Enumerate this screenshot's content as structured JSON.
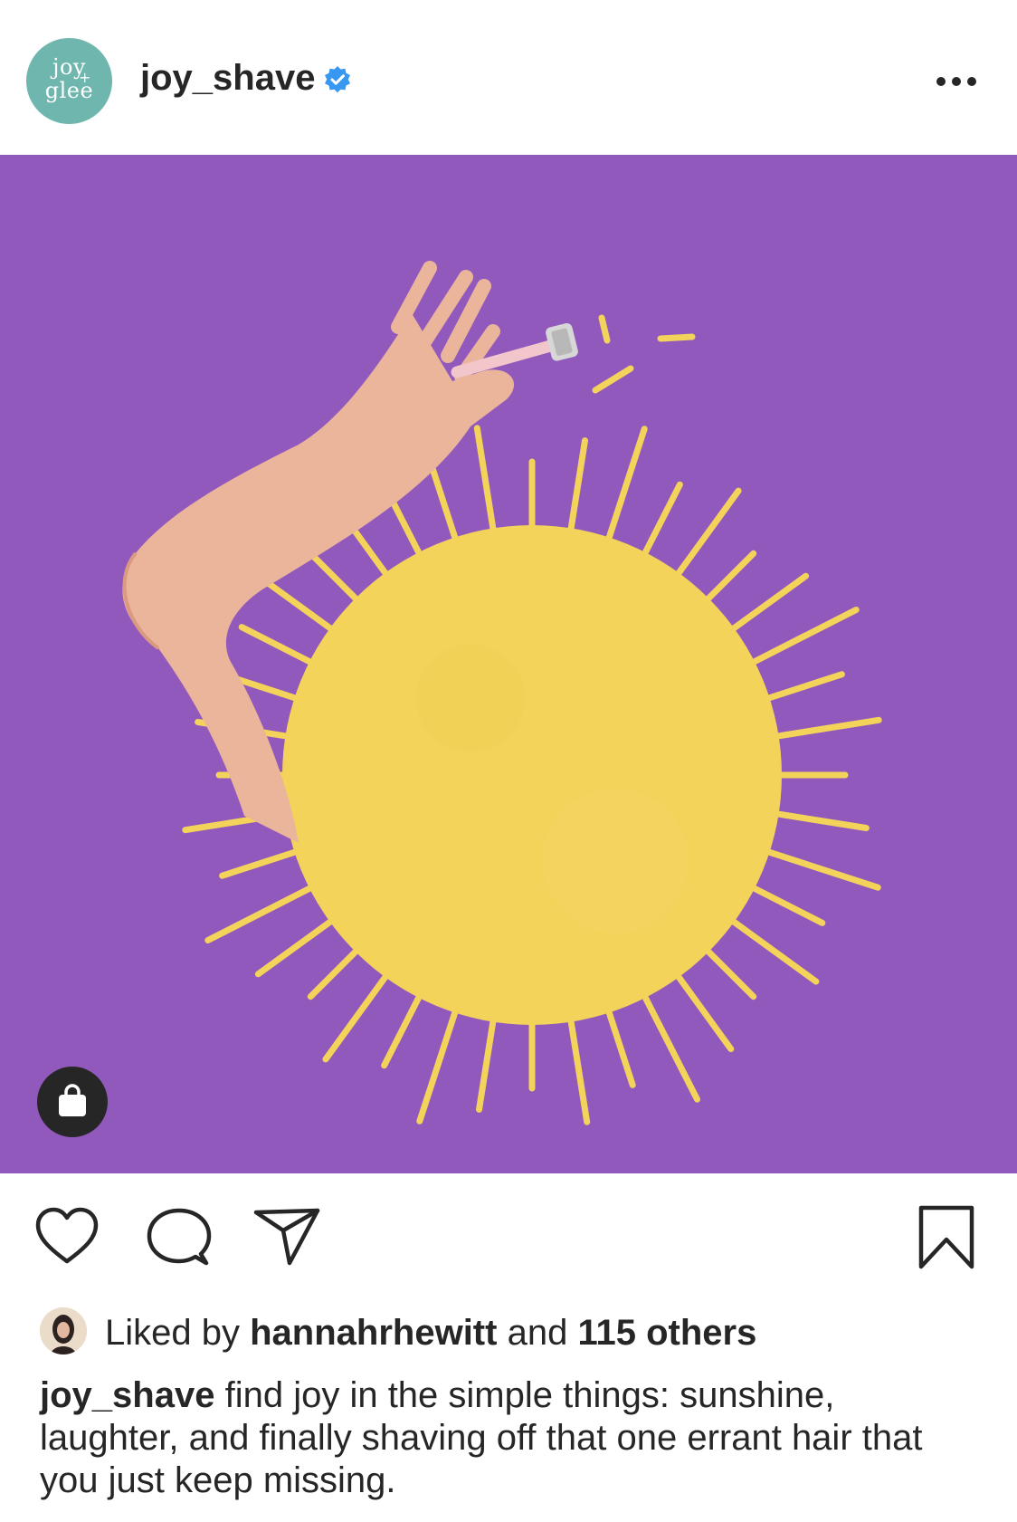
{
  "header": {
    "avatar_text": [
      "joy",
      "+",
      "glee"
    ],
    "username": "joy_shave",
    "verified": true,
    "more_icon": "more-horizontal-icon"
  },
  "post": {
    "image_description_icon": "sun-with-razor-illustration",
    "background_color": "#9259bd",
    "sun_color": "#f3d35a",
    "shop_icon": "shopping-bag-icon"
  },
  "actions": {
    "like_icon": "heart-icon",
    "comment_icon": "comment-icon",
    "share_icon": "send-icon",
    "save_icon": "bookmark-icon"
  },
  "likes": {
    "prefix": "Liked by",
    "user": "hannahrhewitt",
    "middle": "and",
    "count_text": "115 others"
  },
  "caption": {
    "username": "joy_shave",
    "text": "find joy in the simple things: sunshine, laughter, and finally shaving off that one errant hair that you just keep missing."
  }
}
